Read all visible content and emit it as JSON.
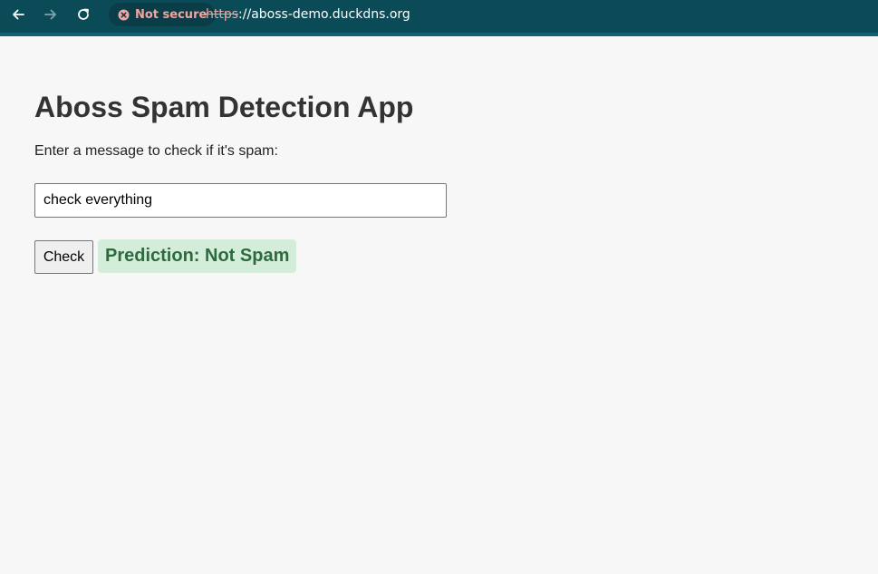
{
  "browser": {
    "security_label": "Not secure",
    "url_scheme": "https",
    "url_rest": "://aboss-demo.duckdns.org",
    "icons": {
      "back": "back-arrow-icon",
      "forward": "forward-arrow-icon",
      "reload": "reload-icon",
      "security": "not-secure-icon"
    },
    "colors": {
      "toolbar": "#0b4b58",
      "warning": "#f0a6a0"
    }
  },
  "app": {
    "title": "Aboss Spam Detection App",
    "prompt": "Enter a message to check if it's spam:",
    "input_value": "check everything",
    "check_label": "Check",
    "prediction": "Prediction: Not Spam",
    "colors": {
      "prediction_bg": "#d4edda",
      "prediction_text": "#2d6a3e",
      "page_bg": "#f7f7f7"
    }
  }
}
